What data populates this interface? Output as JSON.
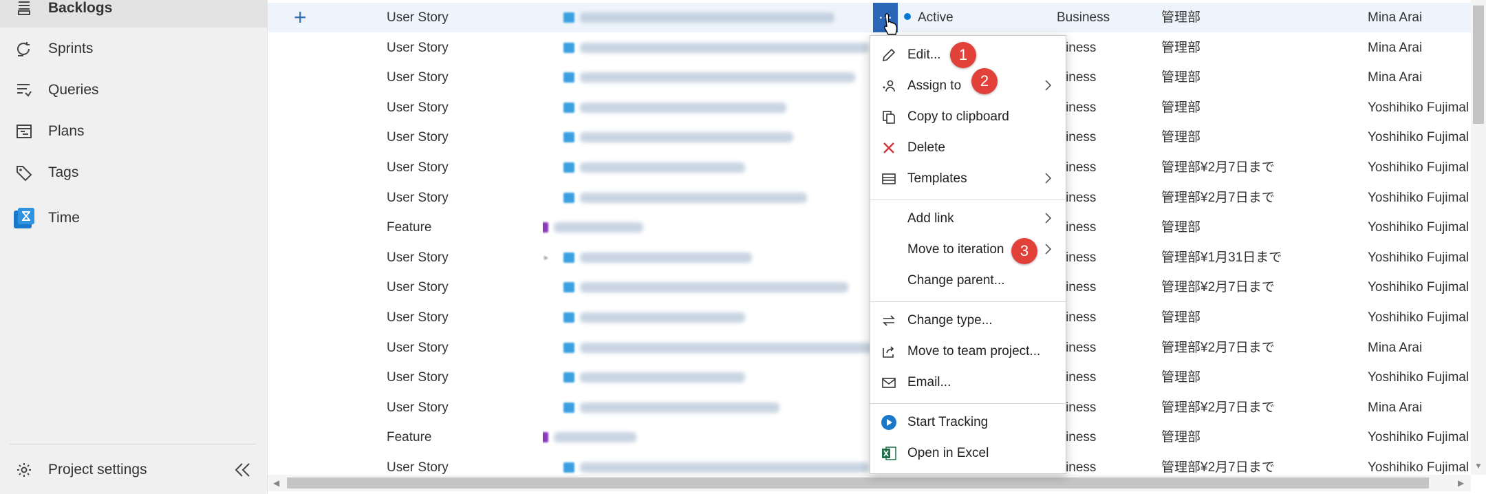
{
  "sidebar": {
    "items": [
      {
        "label": "Backlogs",
        "icon": "backlogs-icon",
        "selected": true
      },
      {
        "label": "Sprints",
        "icon": "sprints-icon"
      },
      {
        "label": "Queries",
        "icon": "queries-icon"
      },
      {
        "label": "Plans",
        "icon": "plans-icon"
      },
      {
        "label": "Tags",
        "icon": "tag-icon"
      },
      {
        "label": "Time",
        "icon": "time-app-icon"
      }
    ],
    "settings_label": "Project settings"
  },
  "rows": [
    {
      "type": "User Story",
      "state": "Active",
      "area": "Business",
      "team": "管理部",
      "assigned": "Mina Arai"
    },
    {
      "type": "User Story",
      "area": "usiness",
      "team": "管理部",
      "assigned": "Mina Arai"
    },
    {
      "type": "User Story",
      "area": "usiness",
      "team": "管理部",
      "assigned": "Mina Arai"
    },
    {
      "type": "User Story",
      "area": "usiness",
      "team": "管理部",
      "assigned": "Yoshihiko Fujimal"
    },
    {
      "type": "User Story",
      "area": "usiness",
      "team": "管理部",
      "assigned": "Yoshihiko Fujimal"
    },
    {
      "type": "User Story",
      "area": "usiness",
      "team": "管理部¥2月7日まで",
      "assigned": "Yoshihiko Fujimal"
    },
    {
      "type": "User Story",
      "area": "usiness",
      "team": "管理部¥2月7日まで",
      "assigned": "Yoshihiko Fujimal"
    },
    {
      "type": "Feature",
      "area": "usiness",
      "team": "管理部",
      "assigned": "Yoshihiko Fujimal"
    },
    {
      "type": "User Story",
      "area": "usiness",
      "team": "管理部¥1月31日まで",
      "assigned": "Yoshihiko Fujimal"
    },
    {
      "type": "User Story",
      "area": "usiness",
      "team": "管理部¥2月7日まで",
      "assigned": "Yoshihiko Fujimal"
    },
    {
      "type": "User Story",
      "area": "usiness",
      "team": "管理部",
      "assigned": "Yoshihiko Fujimal"
    },
    {
      "type": "User Story",
      "area": "usiness",
      "team": "管理部¥2月7日まで",
      "assigned": "Mina Arai"
    },
    {
      "type": "User Story",
      "area": "usiness",
      "team": "管理部",
      "assigned": "Yoshihiko Fujimal"
    },
    {
      "type": "User Story",
      "area": "usiness",
      "team": "管理部¥2月7日まで",
      "assigned": "Mina Arai"
    },
    {
      "type": "Feature",
      "area": "usiness",
      "team": "管理部",
      "assigned": "Yoshihiko Fujimal"
    },
    {
      "type": "User Story",
      "area": "usiness",
      "team": "管理部¥2月7日まで",
      "assigned": "Yoshihiko Fujimal"
    }
  ],
  "menu": {
    "items": [
      {
        "label": "Edit...",
        "icon": "pencil-icon",
        "badge": "1"
      },
      {
        "label": "Assign to",
        "icon": "assign-people-icon",
        "badge": "2",
        "submenu": true
      },
      {
        "label": "Copy to clipboard",
        "icon": "copy-icon"
      },
      {
        "label": "Delete",
        "icon": "delete-x-icon"
      },
      {
        "label": "Templates",
        "icon": "templates-icon",
        "submenu": true
      },
      {
        "label": "Add link",
        "submenu": true
      },
      {
        "label": "Move to iteration",
        "badge": "3",
        "submenu": true
      },
      {
        "label": "Change parent..."
      },
      {
        "label": "Change type...",
        "icon": "swap-arrows-icon"
      },
      {
        "label": "Move to team project...",
        "icon": "move-project-icon"
      },
      {
        "label": "Email...",
        "icon": "mail-icon"
      },
      {
        "label": "Start Tracking",
        "icon": "play-circle-icon"
      },
      {
        "label": "Open in Excel",
        "icon": "excel-icon"
      }
    ]
  },
  "colors": {
    "accent": "#2b66b9",
    "badge": "#e2413a",
    "active_dot": "#0078d4",
    "delete": "#d13438",
    "excel": "#1e7145"
  }
}
